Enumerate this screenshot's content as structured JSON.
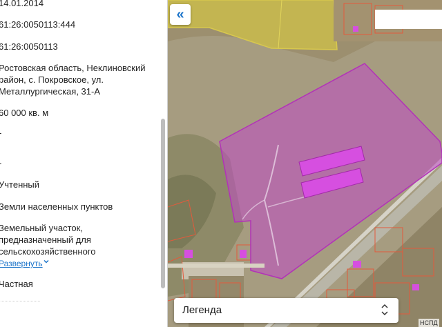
{
  "info_panel": {
    "date": "14.01.2014",
    "cadastral_number": "61:26:0050113:444",
    "cadastral_quarter": "61:26:0050113",
    "address": "Ростовская область, Неклиновский\nрайон, с. Покровское, ул.\nМеталлургическая, 31-А",
    "area": "60 000 кв. м",
    "value_1": "-",
    "value_2": "-",
    "status": "Учтенный",
    "land_category": "Земли населенных пунктов",
    "permitted_use": "Земельный участок,\nпредназначенный для\nсельскохозяйственного",
    "expand_link": "Развернуть",
    "ownership": "Частная"
  },
  "map": {
    "collapse_icon": "double-chevron-left-icon",
    "collapse_glyph": "«",
    "legend_label": "Легенда",
    "attribution": "НСПД",
    "parcel_color": "#c04bc4",
    "building_color": "#d64fe0"
  }
}
